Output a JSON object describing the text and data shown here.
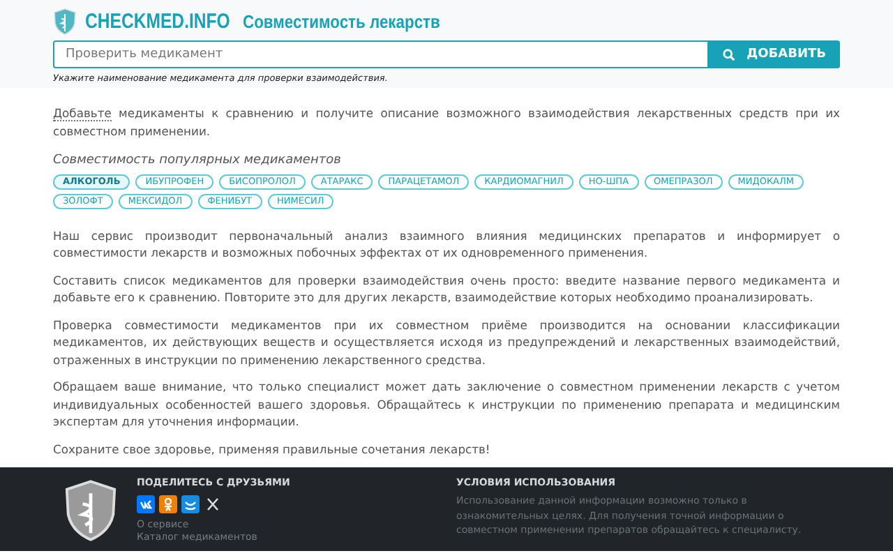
{
  "header": {
    "logo": "CHECKMED.INFO",
    "title": "Совместимость лекарств"
  },
  "search": {
    "placeholder": "Проверить медикамент",
    "button": "ДОБАВИТЬ",
    "hint": "Укажите наименование медикамента для проверки взаимодействия."
  },
  "intro": {
    "link": "Добавьте",
    "text": " медикаменты к сравнению и получите описание возможного взаимодействия лекарственных средств при их совместном применении."
  },
  "popular": {
    "title": "Совместимость популярных медикаментов",
    "tags": [
      {
        "label": "АЛКОГОЛЬ",
        "selected": true
      },
      {
        "label": "ИБУПРОФЕН",
        "selected": false
      },
      {
        "label": "БИСОПРОЛОЛ",
        "selected": false
      },
      {
        "label": "АТАРАКС",
        "selected": false
      },
      {
        "label": "ПАРАЦЕТАМОЛ",
        "selected": false
      },
      {
        "label": "КАРДИОМАГНИЛ",
        "selected": false
      },
      {
        "label": "НО-ШПА",
        "selected": false
      },
      {
        "label": "ОМЕПРАЗОЛ",
        "selected": false
      },
      {
        "label": "МИДОКАЛМ",
        "selected": false
      },
      {
        "label": "ЗОЛОФТ",
        "selected": false
      },
      {
        "label": "МЕКСИДОЛ",
        "selected": false
      },
      {
        "label": "ФЕНИБУТ",
        "selected": false
      },
      {
        "label": "НИМЕСИЛ",
        "selected": false
      }
    ]
  },
  "paragraphs": [
    "Наш сервис производит первоначальный анализ взаимного влияния медицинских препаратов и информирует о совместимости лекарств и возможных побочных эффектах от их одновременного применения.",
    "Составить список медикаментов для проверки взаимодействия очень просто: введите название первого медикамента и добавьте его к сравнению. Повторите это для других лекарств, взаимодействие которых необходимо проанализировать.",
    "Проверка совместимости медикаментов при их совместном приёме производится на основании классификации медикаментов, их действующих веществ и осуществляется исходя из предупреждений и лекарственных взаимодействий, отраженных в инструкции по применению лекарственного средства.",
    "Обращаем ваше внимание, что только специалист может дать заключение о совместном применении лекарств с учетом индивидуальных особенностей вашего здоровья. Обращайтесь к инструкции по применению препарата и медицинским экспертам для уточнения информации.",
    "Сохраните свое здоровье, применяя правильные сочетания лекарств!"
  ],
  "footer": {
    "share_title": "ПОДЕЛИТЕСЬ С ДРУЗЬЯМИ",
    "links": [
      "О сервисе",
      "Каталог медикаментов"
    ],
    "terms_title": "УСЛОВИЯ ИСПОЛЬЗОВАНИЯ",
    "terms_text": "Использование данной информации возможно только в ознакомительных целях. Для получения точной информации о совместном применении препаратов обращайтесь к специалисту."
  }
}
